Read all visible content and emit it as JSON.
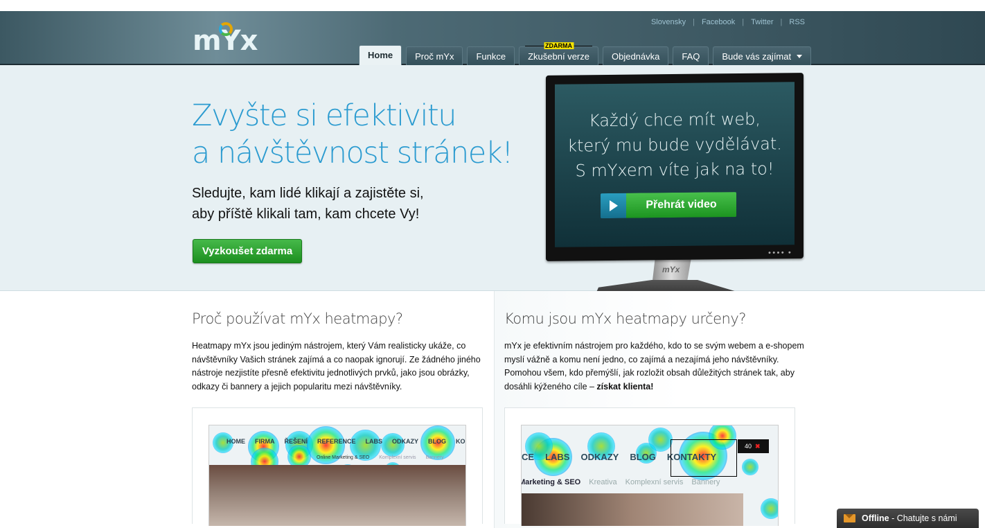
{
  "header": {
    "logo": "mYx",
    "top_links": [
      "Slovensky",
      "Facebook",
      "Twitter",
      "RSS"
    ],
    "nav": [
      {
        "label": "Home",
        "active": true
      },
      {
        "label": "Proč mYx"
      },
      {
        "label": "Funkce"
      },
      {
        "label": "Zkušební verze",
        "badge": "ZDARMA"
      },
      {
        "label": "Objednávka"
      },
      {
        "label": "FAQ"
      },
      {
        "label": "Bude vás zajímat",
        "dropdown": true
      }
    ]
  },
  "hero": {
    "title_line1": "Zvyšte si efektivitu",
    "title_line2": "a návštěvnost stránek!",
    "subtitle_line1": "Sledujte, kam lidé klikají a zajistěte si,",
    "subtitle_line2": "aby příště klikali tam, kam chcete Vy!",
    "cta": "Vyzkoušet zdarma",
    "monitor": {
      "line1": "Každý chce mít web,",
      "line2": "který mu bude vydělávat.",
      "line3": "S mYxem víte jak na to!",
      "play_label": "Přehrát video",
      "stand_logo": "mYx"
    }
  },
  "left": {
    "heading": "Proč používat mYx heatmapy?",
    "text": "Heatmapy mYx jsou jediným nástrojem, který Vám realisticky ukáže, co návštěvníky Vašich stránek zajímá a co naopak ignorují. Ze žádného jiného nástroje nezjistíte přesně efektivitu jednotlivých prvků, jako jsou obrázky, odkazy či bannery a jejich popularitu mezi návštěvníky.",
    "shot_nav": [
      "HOME",
      "FIRMA",
      "ŘEŠENÍ",
      "REFERENCE",
      "LABS",
      "ODKAZY",
      "BLOG",
      "KONTAKTY"
    ],
    "shot_sub": [
      "Online Marketing & SEO",
      "Komplexní servis",
      "Bannery"
    ]
  },
  "right": {
    "heading": "Komu jsou mYx heatmapy určeny?",
    "text": "mYx je efektivním nástrojem pro každého, kdo to se svým webem a e-shopem myslí vážně a komu není jedno, co zajímá a nezajímá jeho návštěvníky. Pomohou všem, kdo přemýšlí, jak rozložit obsah důležitých stránek tak, aby dosáhli kýženého cíle – ",
    "text_bold": "získat klienta!",
    "shot_nav": [
      "CE",
      "LABS",
      "ODKAZY",
      "BLOG",
      "KONTAKTY"
    ],
    "shot_sub": [
      "Marketing & SEO",
      "Kreativa",
      "Komplexní servis",
      "Bannery"
    ],
    "click_count": "40"
  },
  "chat": {
    "status": "Offline",
    "label": " - Chatujte s námi"
  },
  "colors": {
    "accent": "#2b9bd0",
    "cta_green": "#1c8f1f",
    "header": "#3f5a64",
    "hero_bg": "#e7f0f3"
  }
}
